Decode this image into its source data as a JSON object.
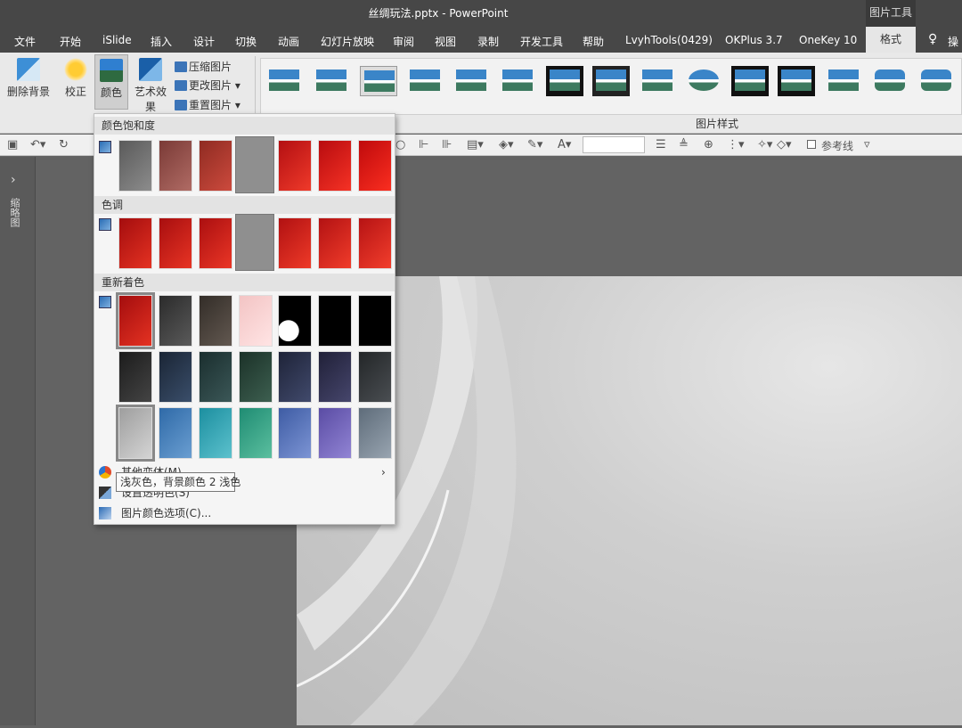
{
  "window": {
    "title": "丝绸玩法.pptx  -  PowerPoint",
    "context_tag": "图片工具"
  },
  "menu": {
    "items": [
      "文件",
      "开始",
      "iSlide",
      "插入",
      "设计",
      "切换",
      "动画",
      "幻灯片放映",
      "审阅",
      "视图",
      "录制",
      "开发工具",
      "帮助",
      "LvyhTools(0429)",
      "OKPlus 3.7",
      "OneKey 10",
      "格式"
    ],
    "active": "格式",
    "lightbulb_label": "操"
  },
  "ribbon": {
    "remove_bg": "删除背景",
    "correct": "校正",
    "color": "颜色",
    "artistic": "艺术效果",
    "compress": "压缩图片",
    "change": "更改图片",
    "reset": "重置图片",
    "styles_group": "图片样式"
  },
  "quick_access": {
    "reference_line": "参考线"
  },
  "left_panel": {
    "label": "缩略图"
  },
  "dropdown": {
    "section_saturation": "颜色饱和度",
    "section_tone": "色调",
    "section_recolor": "重新着色",
    "more_variations": "其他变体(M)",
    "set_transparent": "设置透明色(S)",
    "picture_color_options": "图片颜色选项(C)...",
    "tooltip": "浅灰色，背景颜色 2 浅色"
  },
  "colors": {
    "accent_red": "#c8161b",
    "ribbon_bg": "#e9e9e9",
    "titlebar": "#474747"
  }
}
